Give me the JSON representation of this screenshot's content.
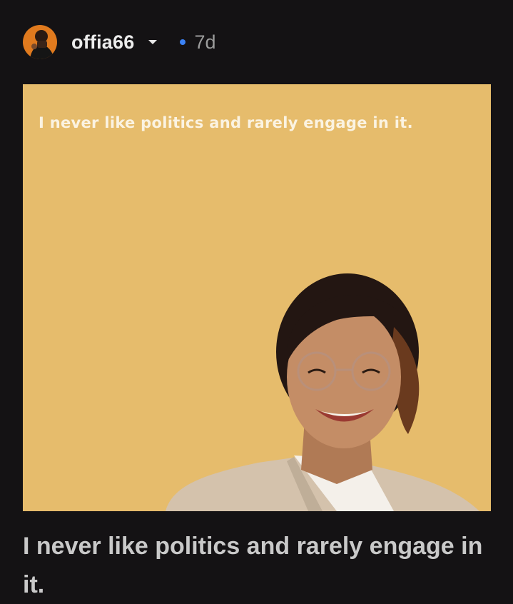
{
  "post": {
    "author": {
      "username": "offia66",
      "avatar_icon": "user-avatar"
    },
    "time_ago": "7d",
    "status_dot_color": "#3b82f6",
    "image": {
      "background_color": "#e6bc6c",
      "overlay_text": "I never like politics and rarely engage in it."
    },
    "caption": "I never like politics and rarely engage in it."
  }
}
